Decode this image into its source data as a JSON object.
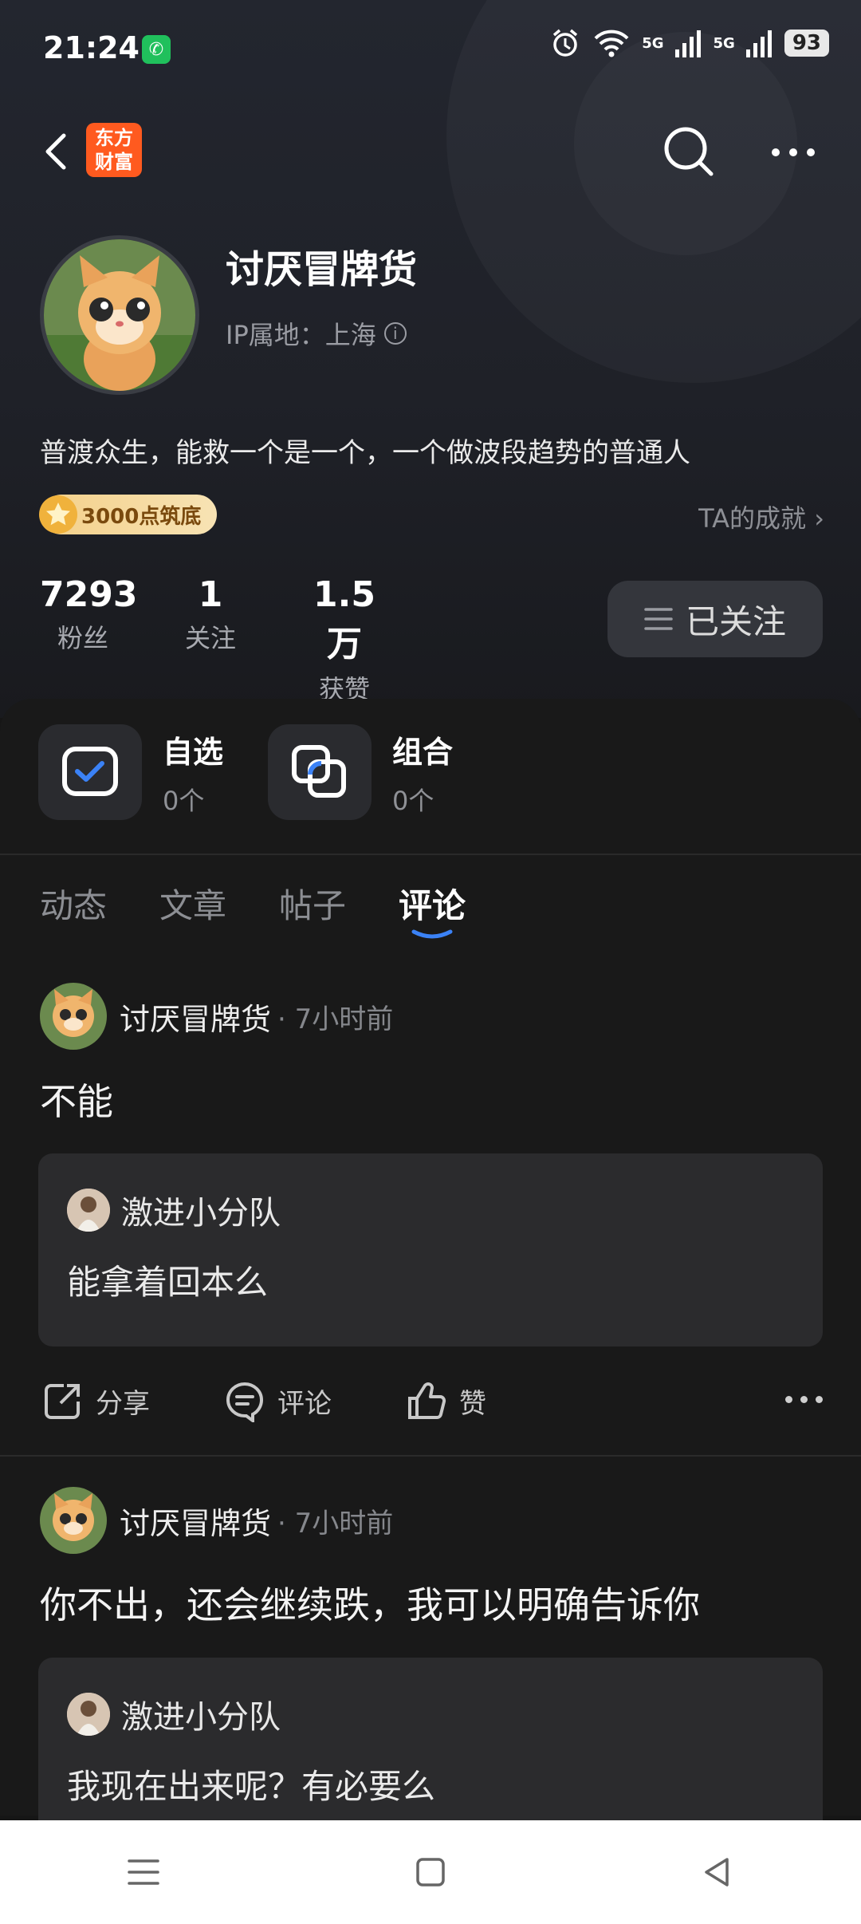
{
  "status_bar": {
    "time": "21:24",
    "network_1": "5G",
    "network_2": "5G",
    "battery": "93"
  },
  "nav": {
    "logo_line1": "东方",
    "logo_line2": "财富"
  },
  "profile": {
    "name": "讨厌冒牌货",
    "ip_location": "IP属地：上海",
    "bio": "普渡众生，能救一个是一个，一个做波段趋势的普通人",
    "badge": "3000点筑底",
    "achievements_link": "TA的成就 ›",
    "stats": [
      {
        "value": "7293",
        "label": "粉丝"
      },
      {
        "value": "1",
        "label": "关注"
      },
      {
        "value": "1.5万",
        "label": "获赞"
      }
    ],
    "follow_button": "已关注"
  },
  "quick_items": [
    {
      "title": "自选",
      "count": "0个",
      "icon": "watchlist-check-icon"
    },
    {
      "title": "组合",
      "count": "0个",
      "icon": "portfolio-icon"
    }
  ],
  "tabs": [
    {
      "label": "动态",
      "active": false
    },
    {
      "label": "文章",
      "active": false
    },
    {
      "label": "帖子",
      "active": false
    },
    {
      "label": "评论",
      "active": true
    }
  ],
  "posts": [
    {
      "author": "讨厌冒牌货",
      "time": "· 7小时前",
      "text": "不能",
      "quote": {
        "author": "激进小分队",
        "text": "能拿着回本么"
      }
    },
    {
      "author": "讨厌冒牌货",
      "time": "· 7小时前",
      "text": "你不出，还会继续跌，我可以明确告诉你",
      "quote": {
        "author": "激进小分队",
        "text": "我现在出来呢？有必要么"
      }
    }
  ],
  "actions": {
    "share": "分享",
    "comment": "评论",
    "like": "赞"
  },
  "colors": {
    "accent": "#3b82f6",
    "logo": "#ff5a1f",
    "badge": "#f4d08a"
  }
}
